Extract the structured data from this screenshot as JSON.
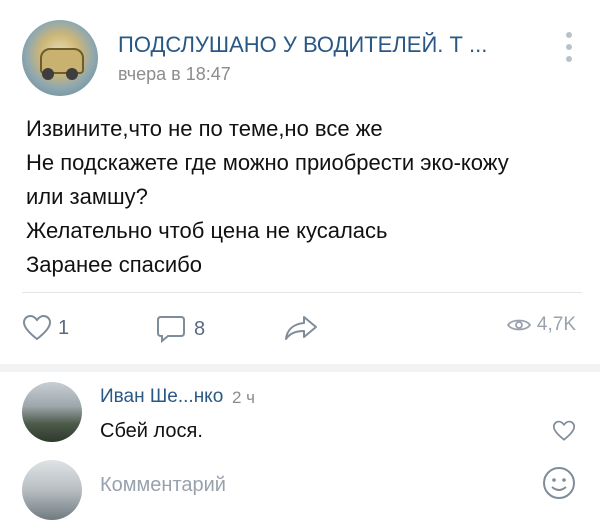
{
  "post": {
    "group_name": "ПОДСЛУШАНО У ВОДИТЕЛЕЙ. Т ...",
    "time": "вчера в 18:47",
    "text_lines": [
      "Извините,что не по теме,но все же",
      "Не подскажете где можно приобрести эко-кожу",
      "или замшу?",
      "Желательно чтоб цена не кусалась",
      "Заранее спасибо"
    ],
    "likes": "1",
    "comments": "8",
    "views": "4,7K"
  },
  "comment": {
    "author": "Иван Ше...нко",
    "time": "2 ч",
    "text": "Сбей лося."
  },
  "reply": {
    "placeholder": "Комментарий"
  },
  "colors": {
    "link": "#2a5885",
    "muted": "#8c8c8c",
    "icon": "#5a6a7e"
  },
  "icons": [
    "more-vertical-icon",
    "heart-icon",
    "comment-icon",
    "share-icon",
    "eye-icon",
    "emoji-icon"
  ]
}
